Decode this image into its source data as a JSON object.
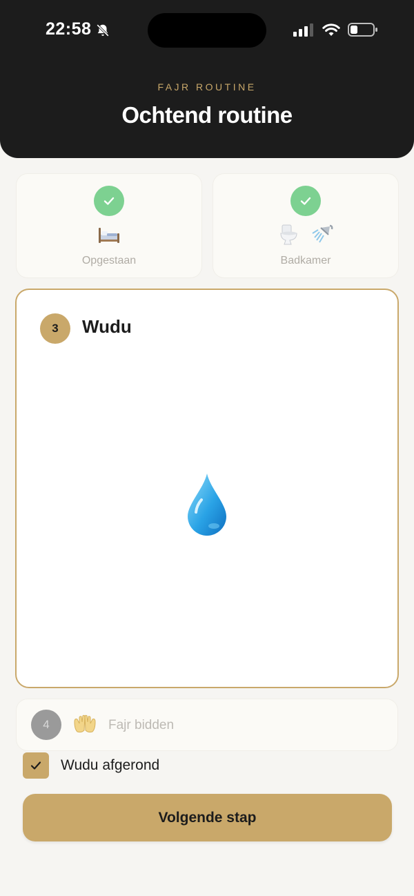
{
  "status_bar": {
    "time": "22:58",
    "icons": [
      "bell-slash-icon",
      "cellular-signal-icon",
      "wifi-icon",
      "battery-low-icon"
    ]
  },
  "header": {
    "eyebrow": "FAJR ROUTINE",
    "title": "Ochtend routine"
  },
  "completed_steps": [
    {
      "label": "Opgestaan",
      "icons": [
        "bed-icon"
      ]
    },
    {
      "label": "Badkamer",
      "icons": [
        "toilet-icon",
        "shower-icon"
      ]
    }
  ],
  "current_step": {
    "number": "3",
    "title": "Wudu",
    "icon": "water-drop-icon"
  },
  "next_step": {
    "number": "4",
    "label": "Fajr bidden",
    "icon": "palms-up-icon"
  },
  "checkbox": {
    "label": "Wudu afgerond",
    "checked": true
  },
  "primary_button": {
    "label": "Volgende stap"
  },
  "colors": {
    "accent_gold": "#c9a86a",
    "header_dark": "#1c1c1c",
    "check_green": "#7dd191",
    "background": "#f6f5f2"
  }
}
